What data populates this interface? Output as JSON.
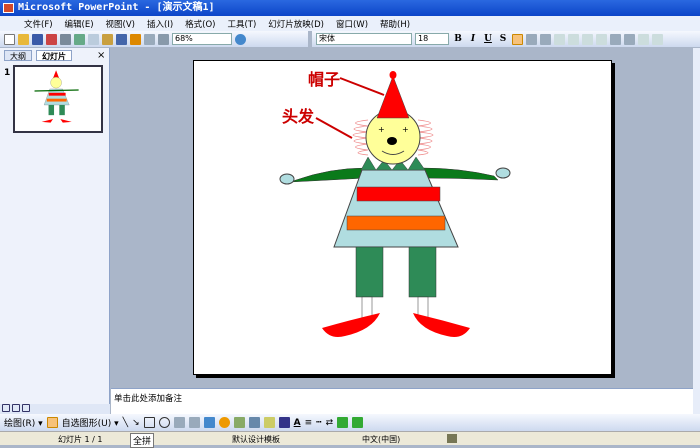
{
  "window": {
    "title": "Microsoft PowerPoint - [演示文稿1]"
  },
  "menu": [
    "文件(F)",
    "编辑(E)",
    "视图(V)",
    "插入(I)",
    "格式(O)",
    "工具(T)",
    "幻灯片放映(D)",
    "窗口(W)",
    "帮助(H)"
  ],
  "toolbar": {
    "zoom": "68%",
    "font": "宋体",
    "font_size": "18",
    "bold": "B",
    "italic": "I",
    "underline": "U",
    "shadow": "S"
  },
  "left_panel": {
    "tabs": [
      "大纲",
      "幻灯片"
    ],
    "close": "×",
    "slide_number": "1"
  },
  "slide": {
    "label_hat": "帽子",
    "label_hair": "头发"
  },
  "notes": {
    "placeholder": "单击此处添加备注"
  },
  "drawing_toolbar": {
    "draw": "绘图(R) ▾",
    "autoshapes": "自选图形(U) ▾"
  },
  "status": {
    "slide": "幻灯片 1 / 1",
    "ime": "全拼",
    "template": "默认设计模板",
    "language": "中文(中国)"
  },
  "colors": {
    "accent": "#0c45c8",
    "hat": "#ff0000",
    "body": "#b0dde0",
    "pants": "#2e8b57"
  }
}
